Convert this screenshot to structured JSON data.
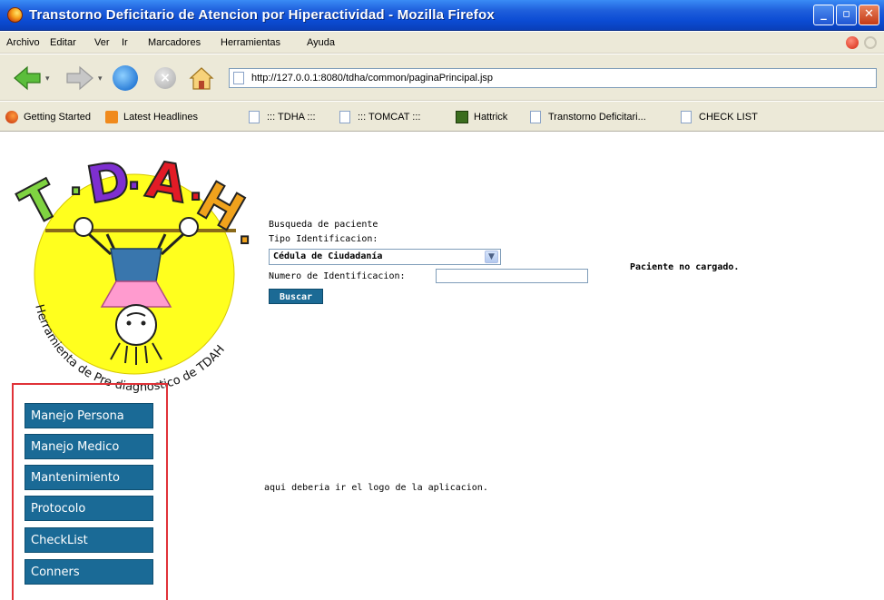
{
  "window": {
    "title": "Transtorno Deficitario de Atencion por Hiperactividad - Mozilla Firefox"
  },
  "menu": [
    "Archivo",
    "Editar",
    "Ver",
    "Ir",
    "Marcadores",
    "Herramientas",
    "Ayuda"
  ],
  "address": {
    "url": "http://127.0.0.1:8080/tdha/common/paginaPrincipal.jsp"
  },
  "bookmarks": [
    {
      "label": "Getting Started",
      "icon": "firefox-icon"
    },
    {
      "label": "Latest Headlines",
      "icon": "rss-icon"
    },
    {
      "label": "::: TDHA :::",
      "icon": "page-icon"
    },
    {
      "label": "::: TOMCAT :::",
      "icon": "page-icon"
    },
    {
      "label": "Hattrick",
      "icon": "hattrick-icon"
    },
    {
      "label": "Transtorno Deficitari...",
      "icon": "page-icon"
    },
    {
      "label": "CHECK LIST",
      "icon": "page-icon"
    }
  ],
  "logo": {
    "letters": [
      "T",
      ".",
      "D",
      ".",
      "A",
      ".",
      "H",
      "."
    ],
    "caption": "Herramienta de Pre-diagnostico de TDAH",
    "colors": {
      "T": "#7fd341",
      "D": "#7e2fd0",
      "A": "#e21b26",
      "H": "#f0a21c",
      "circle": "#ffff1e"
    }
  },
  "search": {
    "heading": "Busqueda de paciente",
    "tipo_label": "Tipo Identificacion:",
    "tipo_value": "Cédula de Ciudadanía",
    "numero_label": "Numero de Identificacion:",
    "numero_value": "",
    "button": "Buscar"
  },
  "status": "Paciente no cargado.",
  "note": "aqui deberia ir el logo de la aplicacion.",
  "sidebar": [
    "Manejo Persona",
    "Manejo Medico",
    "Mantenimiento",
    "Protocolo",
    "CheckList",
    "Conners"
  ],
  "accent": "#1a6a96",
  "highlight_border": "#e03238"
}
